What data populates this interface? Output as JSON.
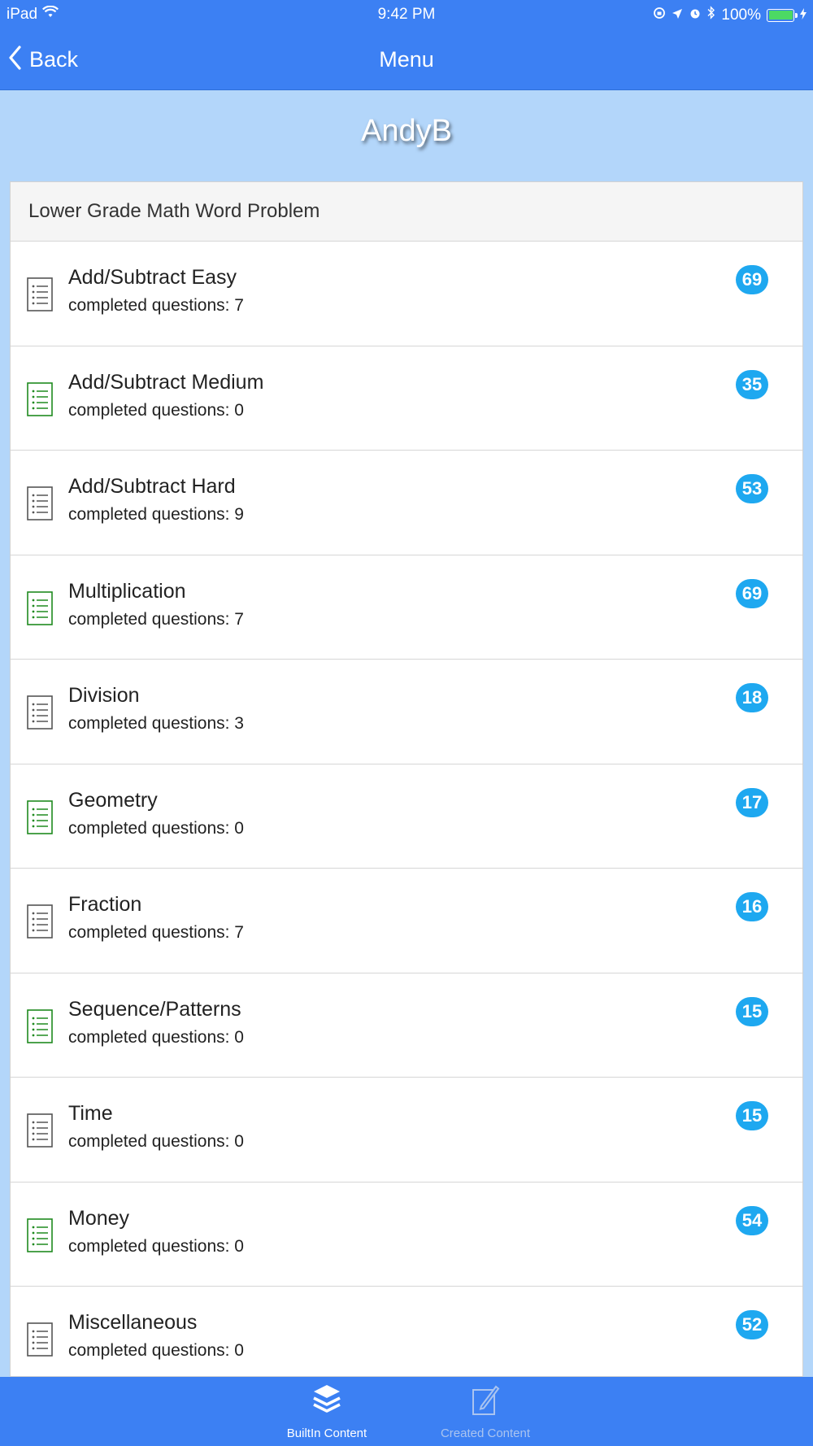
{
  "status_bar": {
    "device": "iPad",
    "time": "9:42 PM",
    "battery": "100%"
  },
  "nav": {
    "back_label": "Back",
    "title": "Menu"
  },
  "user": {
    "name": "AndyB"
  },
  "section": {
    "title": "Lower Grade Math Word Problem"
  },
  "colors": {
    "bar_blue": "#3c80f3",
    "background": "#b3d6fa",
    "badge": "#1ea8f0",
    "icon_green": "#1f8a1f",
    "icon_gray": "#555555"
  },
  "items": [
    {
      "title": "Add/Subtract Easy",
      "subtitle": "completed questions: 7",
      "count": "69",
      "icon": "list-icon",
      "icon_color": "gray"
    },
    {
      "title": "Add/Subtract Medium",
      "subtitle": "completed questions: 0",
      "count": "35",
      "icon": "list-icon",
      "icon_color": "green"
    },
    {
      "title": "Add/Subtract Hard",
      "subtitle": "completed questions: 9",
      "count": "53",
      "icon": "list-icon",
      "icon_color": "gray"
    },
    {
      "title": "Multiplication",
      "subtitle": "completed questions: 7",
      "count": "69",
      "icon": "list-icon",
      "icon_color": "green"
    },
    {
      "title": "Division",
      "subtitle": "completed questions: 3",
      "count": "18",
      "icon": "list-icon",
      "icon_color": "gray"
    },
    {
      "title": "Geometry",
      "subtitle": "completed questions: 0",
      "count": "17",
      "icon": "list-icon",
      "icon_color": "green"
    },
    {
      "title": "Fraction",
      "subtitle": "completed questions: 7",
      "count": "16",
      "icon": "list-icon",
      "icon_color": "gray"
    },
    {
      "title": "Sequence/Patterns",
      "subtitle": "completed questions: 0",
      "count": "15",
      "icon": "list-icon",
      "icon_color": "green"
    },
    {
      "title": "Time",
      "subtitle": "completed questions: 0",
      "count": "15",
      "icon": "list-icon",
      "icon_color": "gray"
    },
    {
      "title": "Money",
      "subtitle": "completed questions: 0",
      "count": "54",
      "icon": "list-icon",
      "icon_color": "green"
    },
    {
      "title": "Miscellaneous",
      "subtitle": "completed questions: 0",
      "count": "52",
      "icon": "list-icon",
      "icon_color": "gray"
    }
  ],
  "tabs": [
    {
      "label": "BuiltIn Content",
      "icon": "layers-icon",
      "active": true
    },
    {
      "label": "Created Content",
      "icon": "edit-icon",
      "active": false
    }
  ]
}
